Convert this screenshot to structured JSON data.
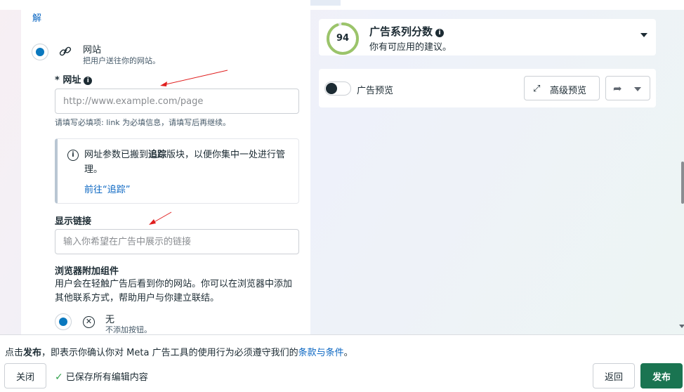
{
  "editor": {
    "top_link": "解",
    "website_option": {
      "title": "网站",
      "description": "把用户送往你的网站。"
    },
    "url_field": {
      "label": "* 网址",
      "placeholder": "http://www.example.com/page",
      "error": "请填写必填项: link 为必填信息，请填写后再继续。"
    },
    "notice": {
      "text_before": "网址参数已搬到",
      "text_bold": "追踪",
      "text_after": "版块，以便你集中一处进行管理。",
      "link": "前往“追踪”"
    },
    "display_link": {
      "label": "显示链接",
      "placeholder": "输入你希望在广告中展示的链接"
    },
    "browser_addon": {
      "title": "浏览器附加组件",
      "description": "用户会在轻触广告后看到你的网站。你可以在浏览器中添加其他联系方式，帮助用户与你建立联结。",
      "none_title": "无",
      "none_description": "不添加按钮。"
    }
  },
  "score_card": {
    "score": "94",
    "score_fraction": 0.94,
    "title": "广告系列分数",
    "subtitle": "你有可应用的建议。",
    "ring_color": "#9bc46a"
  },
  "preview_card": {
    "toggle_label": "广告预览",
    "advanced_button": "高级预览"
  },
  "footer": {
    "terms_prefix": "点击",
    "terms_bold": "发布",
    "terms_middle": "，即表示你确认你对 Meta 广告工具的使用行为必须遵守我们的",
    "terms_link": "条款与条件",
    "terms_suffix": "。",
    "close_button": "关闭",
    "saved_status": "已保存所有编辑内容",
    "back_button": "返回",
    "publish_button": "发布"
  },
  "colors": {
    "link": "#0a66c2",
    "radio_selected": "#0a78be",
    "publish": "#1a7451",
    "annotation_arrow": "#e01e1e",
    "saved_check": "#31a24c"
  },
  "icons": [
    "link-icon",
    "info-icon",
    "close-circle-icon",
    "expand-icon",
    "share-icon",
    "chevron-down-icon",
    "check-icon"
  ]
}
